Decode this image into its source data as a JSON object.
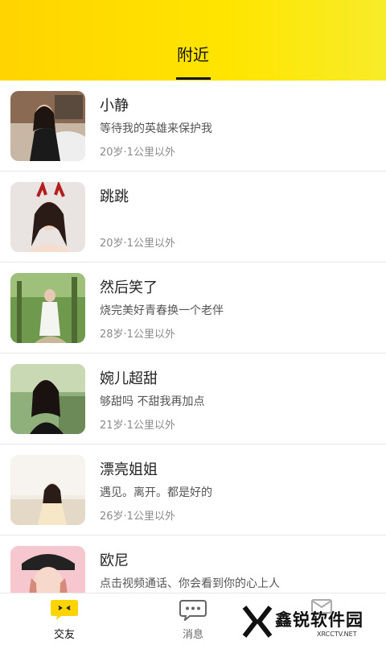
{
  "header": {
    "tab_label": "附近"
  },
  "users": [
    {
      "name": "小静",
      "bio": "等待我的英雄来保护我",
      "meta": "20岁·1公里以外"
    },
    {
      "name": "跳跳",
      "bio": "",
      "meta": "20岁·1公里以外"
    },
    {
      "name": "然后笑了",
      "bio": "烧完美好青春换一个老伴",
      "meta": "28岁·1公里以外"
    },
    {
      "name": "婉儿超甜",
      "bio": "够甜吗 不甜我再加点",
      "meta": "21岁·1公里以外"
    },
    {
      "name": "漂亮姐姐",
      "bio": "遇见。离开。都是好的",
      "meta": "26岁·1公里以外"
    },
    {
      "name": "欧尼",
      "bio": "点击视频通话、你会看到你的心上人",
      "meta": ""
    }
  ],
  "tabbar": {
    "items": [
      {
        "label": "交友",
        "icon": "chat-bubble-yellow-icon",
        "active": true
      },
      {
        "label": "消息",
        "icon": "message-icon",
        "active": false
      },
      {
        "label": "",
        "icon": "mail-icon",
        "active": false
      }
    ]
  },
  "watermark": {
    "text": "鑫锐软件园",
    "sub": "XRCCTV.NET"
  },
  "colors": {
    "accent": "#ffd400",
    "text": "#222222",
    "muted": "#8a8a8a"
  }
}
